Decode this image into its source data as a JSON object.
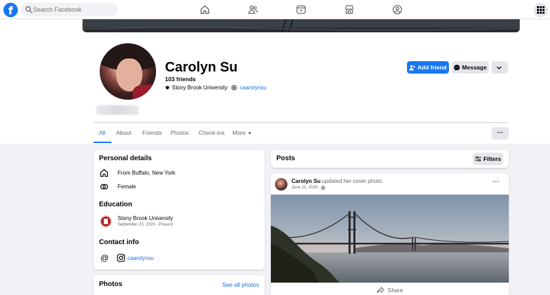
{
  "search": {
    "placeholder": "Search Facebook"
  },
  "nav": {
    "logo": "f"
  },
  "profile": {
    "name": "Carolyn Su",
    "friends": "103 friends",
    "school": "Stony Brook University",
    "handle": "caarolynsu"
  },
  "actions": {
    "add_friend": "Add friend",
    "message": "Message"
  },
  "tabs": {
    "all": "All",
    "about": "About",
    "friends": "Friends",
    "photos": "Photos",
    "checkins": "Check-ins",
    "more": "More",
    "more_btn": "⋯"
  },
  "details": {
    "personal_title": "Personal details",
    "from": "From Buffalo, New York",
    "gender": "Female",
    "education_title": "Education",
    "edu_name": "Stony Brook University",
    "edu_dates": "September 23, 2023 - Present",
    "contact_title": "Contact info",
    "contact_handle": "caarolynsu"
  },
  "photos": {
    "title": "Photos",
    "see_all": "See all photos"
  },
  "posts": {
    "title": "Posts",
    "filters": "Filters",
    "post": {
      "author": "Carolyn Su",
      "action": "updated her cover photo.",
      "date": "June 21, 2025",
      "menu": "⋯",
      "share": "Share"
    }
  },
  "colors": {
    "brand": "#1877f2",
    "link": "#216fdb",
    "secondary_bg": "#e4e6eb",
    "page_bg": "#f0f2f5"
  }
}
